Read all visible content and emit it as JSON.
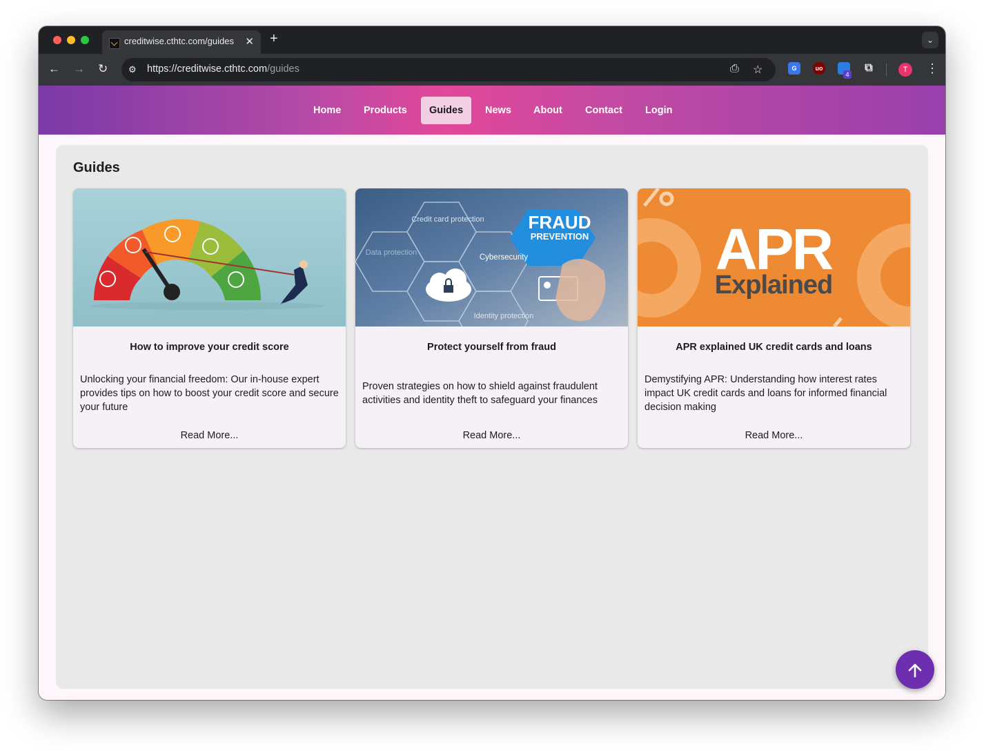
{
  "browser": {
    "tab_title": "creditwise.cthtc.com/guides",
    "url_host": "https://creditwise.cthtc.com",
    "url_path": "/guides",
    "avatar_initial": "T",
    "extension_badge": "4"
  },
  "nav": {
    "items": [
      {
        "label": "Home"
      },
      {
        "label": "Products"
      },
      {
        "label": "Guides"
      },
      {
        "label": "News"
      },
      {
        "label": "About"
      },
      {
        "label": "Contact"
      },
      {
        "label": "Login"
      }
    ],
    "active": "Guides"
  },
  "page": {
    "title": "Guides"
  },
  "cards": [
    {
      "title": "How to improve your credit score",
      "description": "Unlocking your financial freedom: Our in-house expert provides tips on how to boost your credit score and secure your future",
      "link": "Read More..."
    },
    {
      "title": "Protect yourself from fraud",
      "description": "Proven strategies on how to shield against fraudulent activities and identity theft to safeguard your finances",
      "link": "Read More...",
      "image_text": {
        "heading": "FRAUD",
        "subheading": "PREVENTION",
        "labels": [
          "Credit card protection",
          "Data protection",
          "Cybersecurity",
          "Identity protection"
        ]
      }
    },
    {
      "title": "APR explained UK credit cards and loans",
      "description": "Demystifying APR: Understanding how interest rates impact UK credit cards and loans for informed financial decision making",
      "link": "Read More...",
      "image_text": {
        "heading": "APR",
        "subheading": "Explained"
      }
    }
  ],
  "colors": {
    "nav_gradient_start": "#7b3aa8",
    "nav_gradient_mid": "#e3489a",
    "active_tab_bg": "#f3cfe4",
    "fab": "#6e2eb0",
    "panel_bg": "#e9e9ea",
    "card_bg": "#f6f0f7"
  },
  "icons": {
    "fab": "arrow-up-icon"
  }
}
